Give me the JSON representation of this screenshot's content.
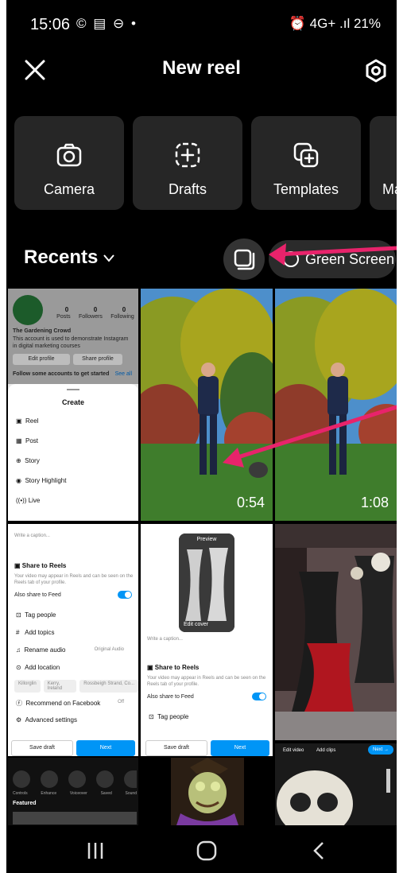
{
  "status": {
    "time": "15:06",
    "left_icons": "© ▤ ⊖ •",
    "right": "⏰ 4G+ .ıl 21%"
  },
  "header": {
    "title": "New reel"
  },
  "tiles": [
    {
      "label": "Camera",
      "icon": "camera-icon"
    },
    {
      "label": "Drafts",
      "icon": "drafts-icon"
    },
    {
      "label": "Templates",
      "icon": "templates-icon"
    },
    {
      "label": "Ma",
      "icon": "more-icon"
    }
  ],
  "recents": {
    "label": "Recents",
    "green_screen": "Green Screen"
  },
  "media": {
    "video1_duration": "0:54",
    "video2_duration": "1:08"
  },
  "profile_thumb": {
    "posts": "0",
    "followers": "0",
    "following": "0",
    "posts_label": "Posts",
    "followers_label": "Followers",
    "following_label": "Following",
    "name": "The Gardening Crowd",
    "bio": "This account is used to demonstrate Instagram in digital marketing courses",
    "edit_profile": "Edit profile",
    "share_profile": "Share profile",
    "follow_some": "Follow some accounts to get started",
    "see_all": "See all",
    "create_title": "Create",
    "create_items": [
      "Reel",
      "Post",
      "Story",
      "Story Highlight",
      "Live"
    ]
  },
  "share_thumb_1": {
    "caption_placeholder": "Write a caption...",
    "share_to_reels": "Share to Reels",
    "share_desc": "Your video may appear in Reels and can be seen on the Reels tab of your profile.",
    "also_share": "Also share to Feed",
    "items": [
      "Tag people",
      "Add topics",
      "Rename audio",
      "Add location"
    ],
    "rename_value": "Original Audio",
    "location_chips": [
      "Killorglin",
      "Kerry, Ireland",
      "Rossbeigh Strand, Co..."
    ],
    "recommend": "Recommend on Facebook",
    "recommend_value": "Off",
    "advanced": "Advanced settings",
    "save_draft": "Save draft",
    "next": "Next"
  },
  "share_thumb_2": {
    "preview": "Preview",
    "edit_cover": "Edit cover",
    "caption_placeholder": "Write a caption...",
    "share_to_reels": "Share to Reels",
    "share_desc": "Your video may appear in Reels and can be seen on the Reels tab of your profile.",
    "also_share": "Also share to Feed",
    "tag_people": "Tag people",
    "save_draft": "Save draft",
    "next": "Next"
  },
  "editor_thumb": {
    "edit_video": "Edit video",
    "add_clips": "Add clips",
    "next": "Next →"
  },
  "tools_thumb": {
    "labels": [
      "Controls",
      "Enhance",
      "Voiceover",
      "Saved",
      "Sound"
    ],
    "featured": "Featured"
  },
  "colors": {
    "accent": "#0095f6",
    "arrow": "#e8236b",
    "tile_bg": "#262626"
  }
}
